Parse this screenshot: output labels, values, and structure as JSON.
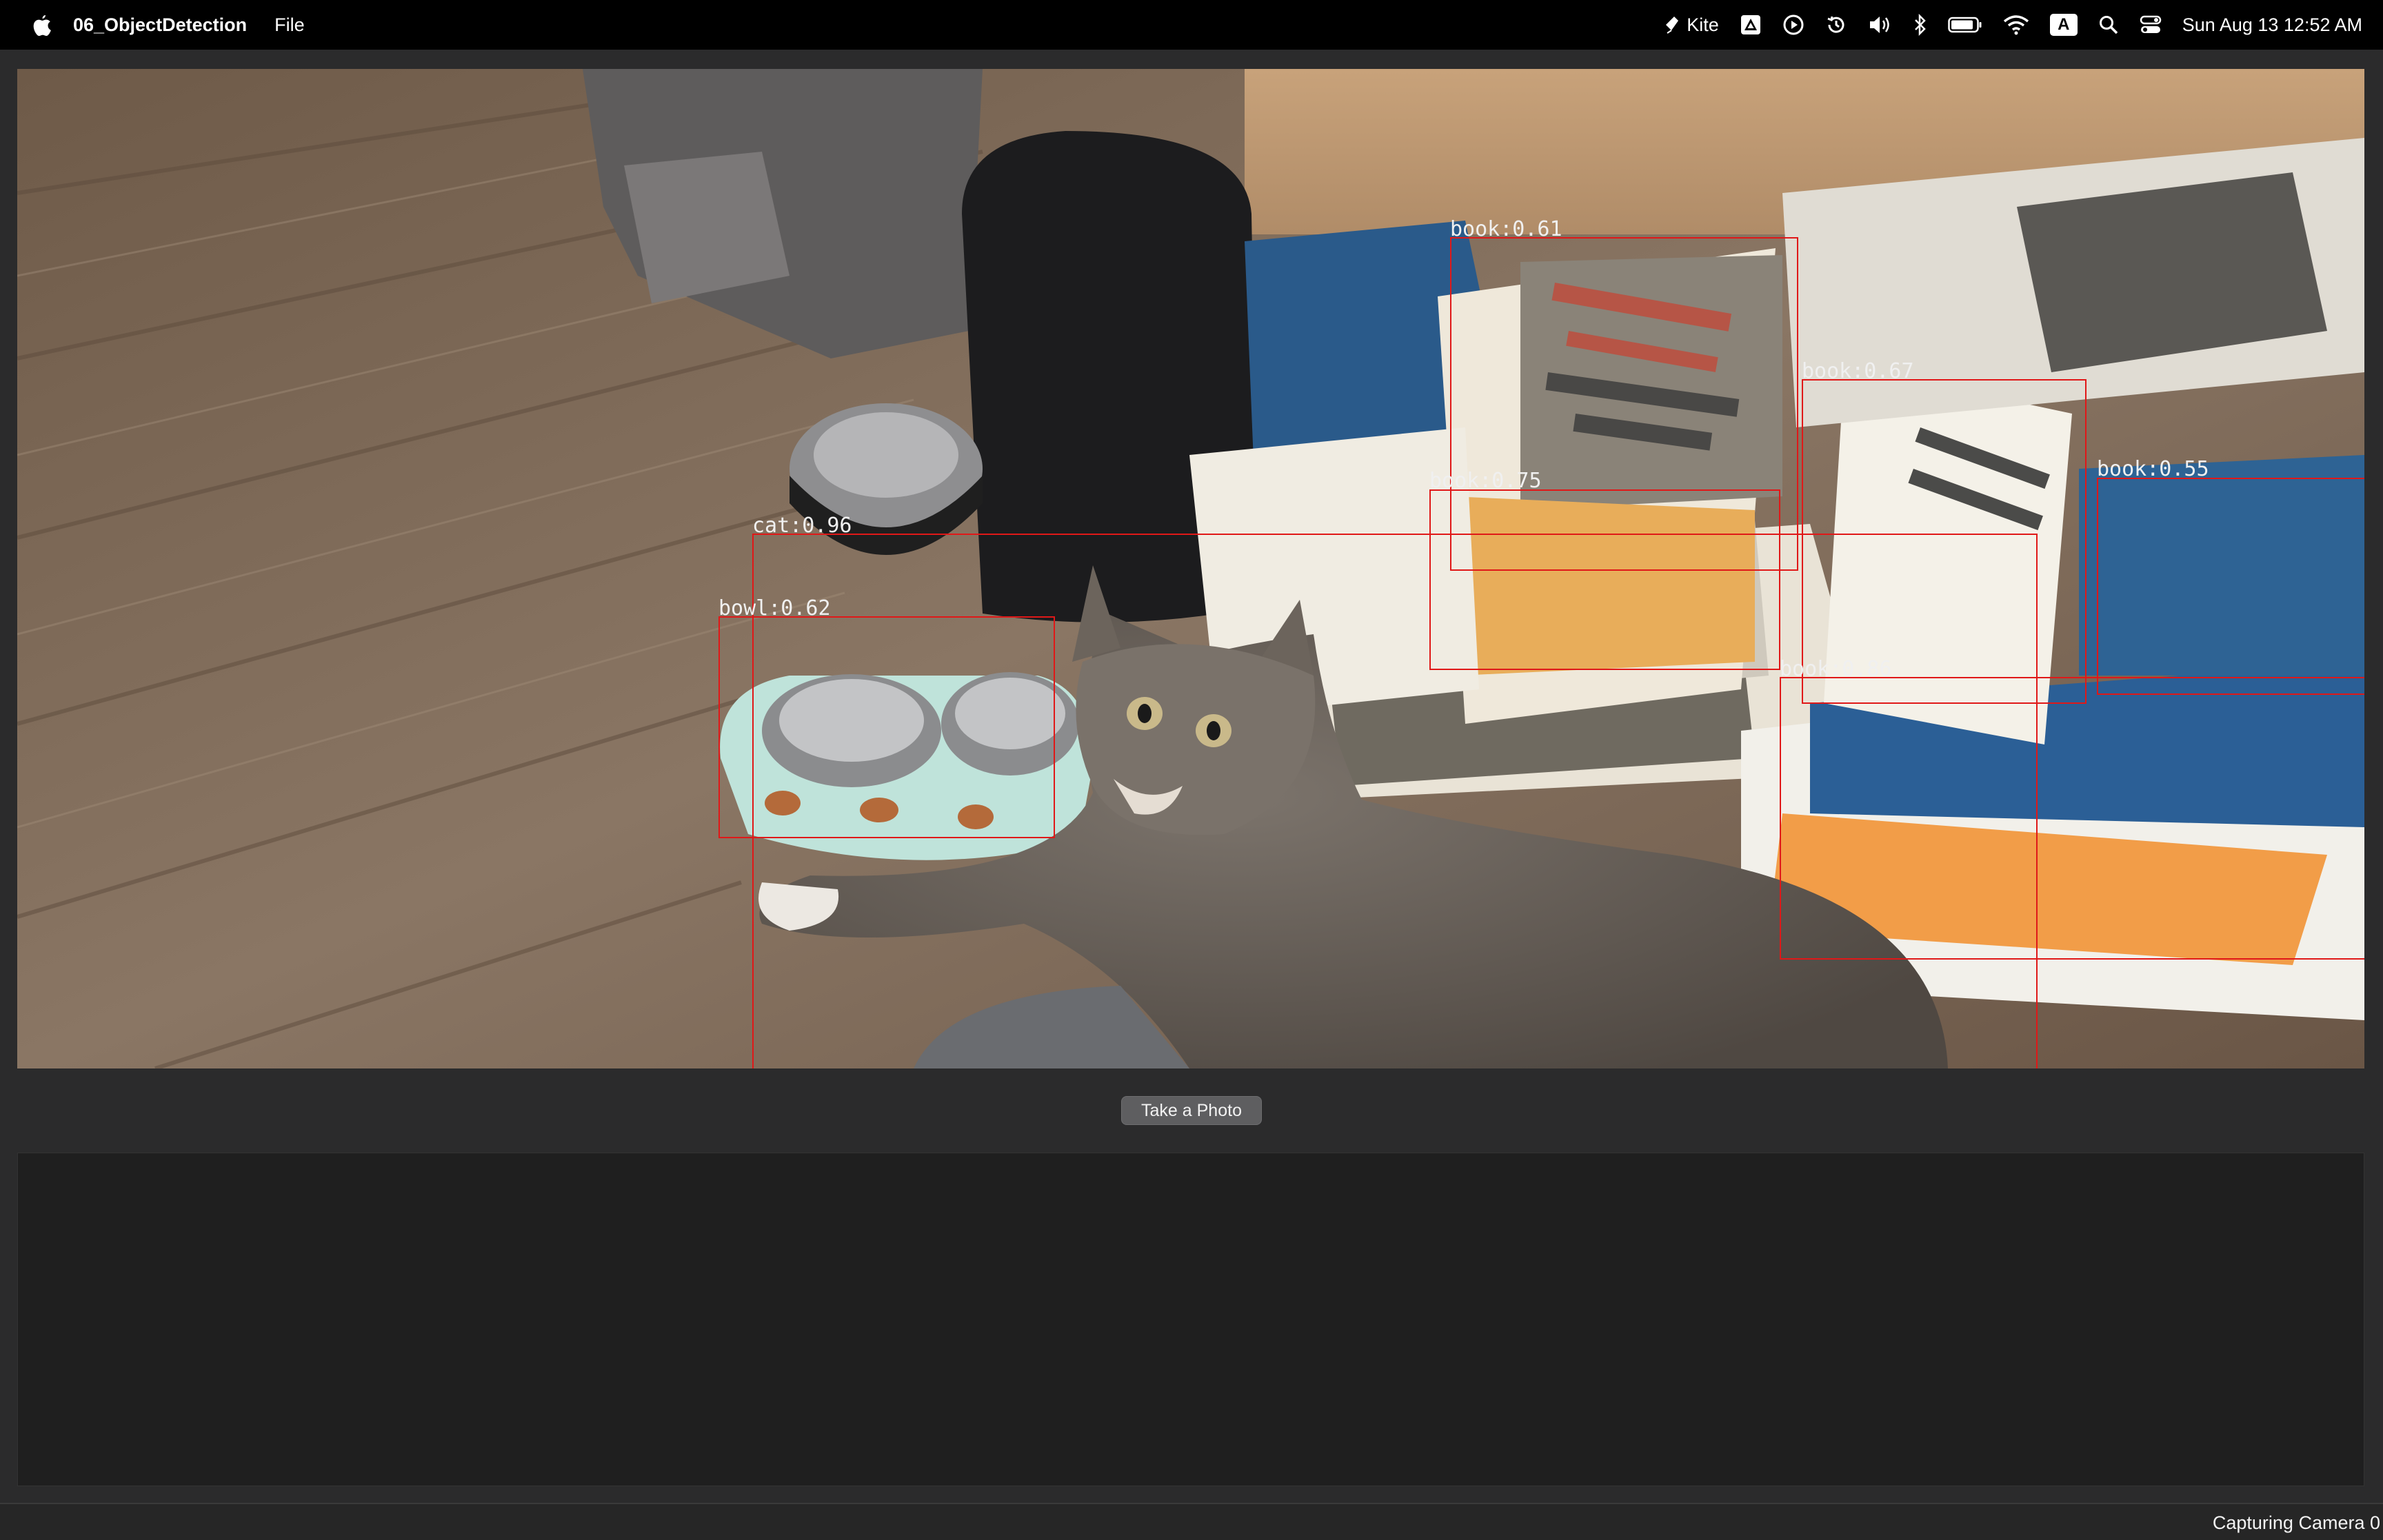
{
  "menubar": {
    "app_name": "06_ObjectDetection",
    "menu_items": [
      "File"
    ],
    "kite_label": "Kite",
    "input_source": "A",
    "clock": "Sun Aug 13  12:52 AM",
    "icons": [
      "apple-icon",
      "kite-icon",
      "drive-icon",
      "play-icon",
      "time-machine-icon",
      "volume-icon",
      "bluetooth-icon",
      "battery-icon",
      "wifi-icon",
      "input-source-icon",
      "spotlight-icon",
      "control-center-icon"
    ]
  },
  "detections": [
    {
      "label": "book:0.61",
      "class": "book",
      "confidence": 0.61
    },
    {
      "label": "book:0.67",
      "class": "book",
      "confidence": 0.67
    },
    {
      "label": "book:0.55",
      "class": "book",
      "confidence": 0.55
    },
    {
      "label": "book:0.75",
      "class": "book",
      "confidence": 0.75
    },
    {
      "label": "cat:0.96",
      "class": "cat",
      "confidence": 0.96
    },
    {
      "label": "bowl:0.62",
      "class": "bowl",
      "confidence": 0.62
    },
    {
      "label": "book:0.86",
      "class": "book",
      "confidence": 0.86
    }
  ],
  "colors": {
    "box": "#e01818",
    "menubar": "#000000",
    "window": "#2b2b2c",
    "panel": "#1f1f1f"
  },
  "controls": {
    "take_photo_label": "Take a Photo"
  },
  "status": {
    "text": "Capturing Camera 0"
  }
}
